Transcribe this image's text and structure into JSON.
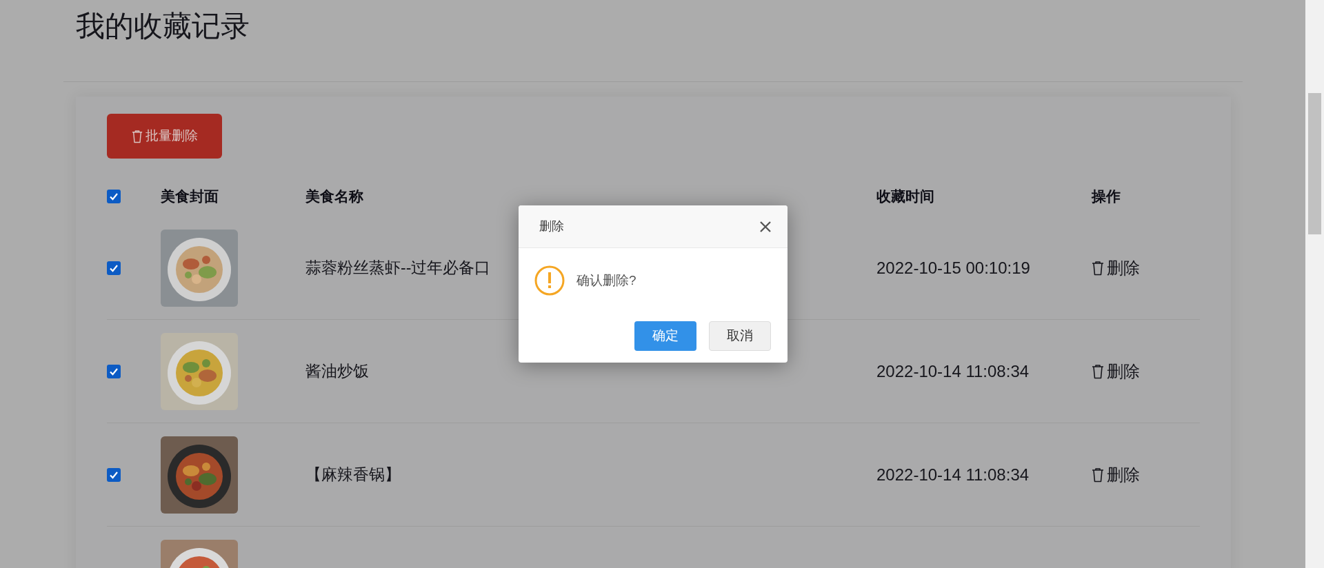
{
  "page": {
    "title": "我的收藏记录"
  },
  "batch_delete_button": {
    "label": "批量删除"
  },
  "table": {
    "select_all": {
      "checked": true
    },
    "columns": [
      "美食封面",
      "美食名称",
      "收藏时间",
      "操作"
    ],
    "rows": [
      {
        "checked": true,
        "name": "蒜蓉粉丝蒸虾--过年必备口",
        "time": "2022-10-15 00:10:19",
        "action": "删除"
      },
      {
        "checked": true,
        "name": "酱油炒饭",
        "time": "2022-10-14 11:08:34",
        "action": "删除"
      },
      {
        "checked": true,
        "name": "【麻辣香锅】",
        "time": "2022-10-14 11:08:34",
        "action": "删除"
      }
    ]
  },
  "dialog": {
    "title": "删除",
    "message": "确认删除?",
    "confirm": "确定",
    "cancel": "取消"
  }
}
